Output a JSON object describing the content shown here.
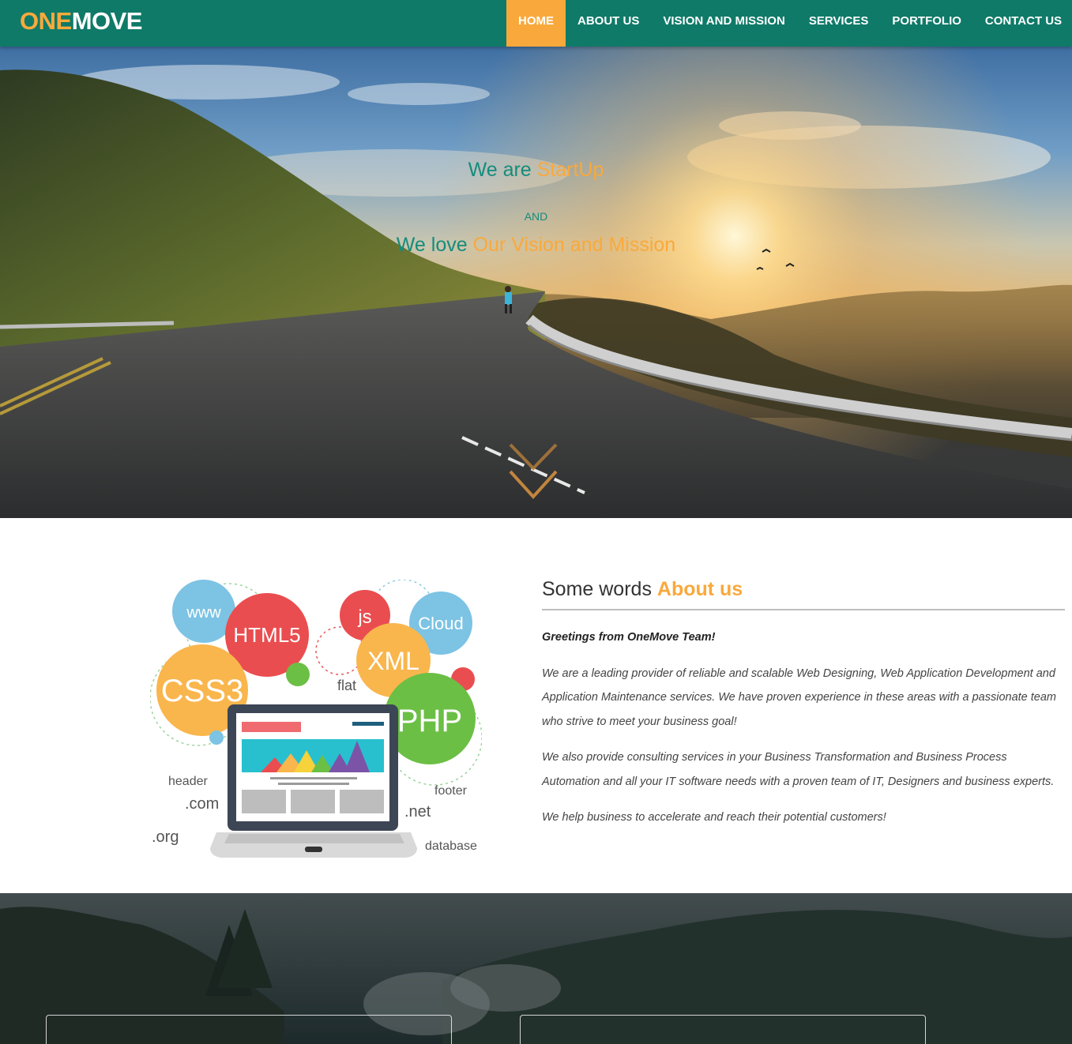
{
  "brand": {
    "part1": "ONE",
    "part2": "MOVE"
  },
  "nav": {
    "items": [
      {
        "label": "HOME"
      },
      {
        "label": "ABOUT US"
      },
      {
        "label": "VISION AND MISSION"
      },
      {
        "label": "SERVICES"
      },
      {
        "label": "PORTFOLIO"
      },
      {
        "label": "CONTACT US"
      }
    ],
    "active_index": 0
  },
  "hero": {
    "line1_a": "We are ",
    "line1_b": "StartUp",
    "and": "AND",
    "line2_a": "We love ",
    "line2_b": "Our Vision and Mission"
  },
  "illustration": {
    "labels": {
      "www": "www",
      "html5": "HTML5",
      "js": "js",
      "cloud": "Cloud",
      "xml": "XML",
      "css3": "CSS3",
      "flat": "flat",
      "php": "PHP",
      "header": "header",
      "com": ".com",
      "footer": "footer",
      "net": ".net",
      "org": ".org",
      "database": "database"
    }
  },
  "about": {
    "title_a": "Some words ",
    "title_b": "About us",
    "greeting": "Greetings from OneMove Team!",
    "p1": "We are a leading provider of reliable and scalable Web Designing, Web Application Development and Application Maintenance services. We have proven experience in these areas with a passionate team who strive to meet your business goal!",
    "p2": "We also provide consulting services in your Business Transformation and Business Process Automation and all your IT software needs with a proven team of IT, Designers and business experts.",
    "p3": "We help business to accelerate and reach their potential customers!"
  },
  "colors": {
    "brand_green": "#0f7a68",
    "accent_orange": "#f9a93c",
    "hero_text_teal": "#158c7c"
  }
}
